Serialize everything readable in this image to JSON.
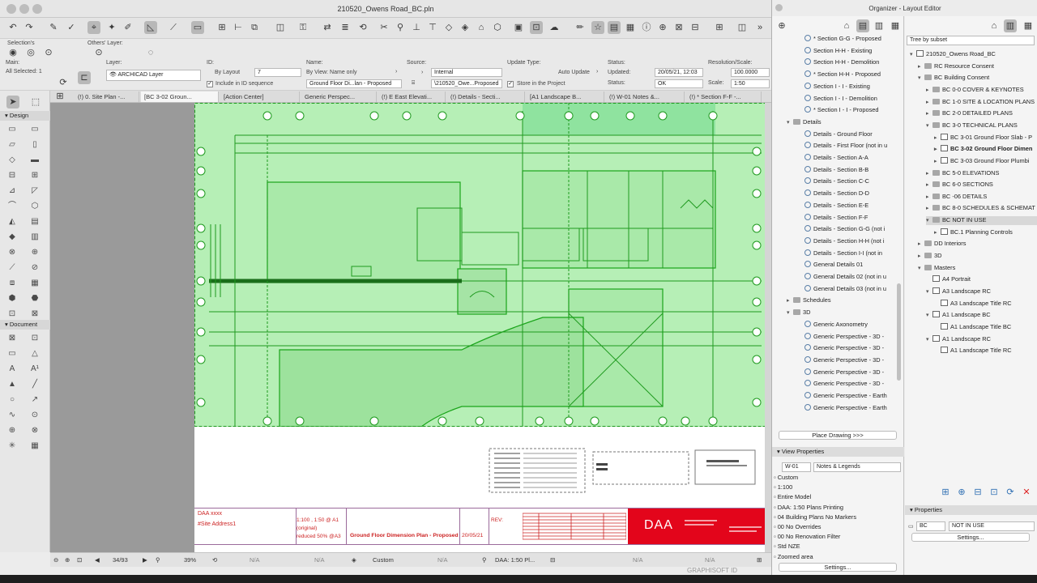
{
  "window": {
    "title": "210520_Owens Road_BC.pln"
  },
  "organizer": {
    "title": "Organizer - Layout Editor",
    "tree_mode": "Tree by subset",
    "left_items": [
      {
        "label": "* Section G-G - Proposed",
        "icon": "view"
      },
      {
        "label": "Section H-H - Existing",
        "icon": "view"
      },
      {
        "label": "Section H-H - Demolition",
        "icon": "view"
      },
      {
        "label": "* Section H-H - Proposed",
        "icon": "view"
      },
      {
        "label": "Section I - I - Existing",
        "icon": "view"
      },
      {
        "label": "Section I - I - Demolition",
        "icon": "view"
      },
      {
        "label": "* Section I - I - Proposed",
        "icon": "view"
      },
      {
        "label": "Details",
        "icon": "folder",
        "folder": true
      },
      {
        "label": "Details - Ground Floor",
        "icon": "view"
      },
      {
        "label": "Details - First Floor (not in u",
        "icon": "view"
      },
      {
        "label": "Details - Section A-A",
        "icon": "view"
      },
      {
        "label": "Details - Section B-B",
        "icon": "view"
      },
      {
        "label": "Details - Section C-C",
        "icon": "view"
      },
      {
        "label": "Details - Section D-D",
        "icon": "view"
      },
      {
        "label": "Details - Section E-E",
        "icon": "view"
      },
      {
        "label": "Details - Section F-F",
        "icon": "view"
      },
      {
        "label": "Details - Section G-G (not i",
        "icon": "view"
      },
      {
        "label": "Details - Section H-H (not i",
        "icon": "view"
      },
      {
        "label": "Details - Section I-I (not in",
        "icon": "view"
      },
      {
        "label": "General Details 01",
        "icon": "view"
      },
      {
        "label": "General Details 02 (not in u",
        "icon": "view"
      },
      {
        "label": "General Details 03 (not in u",
        "icon": "view"
      },
      {
        "label": "Schedules",
        "icon": "folder",
        "folder": true,
        "collapsed": true
      },
      {
        "label": "3D",
        "icon": "folder",
        "folder": true
      },
      {
        "label": "Generic Axonometry",
        "icon": "view"
      },
      {
        "label": "Generic Perspective - 3D -",
        "icon": "view"
      },
      {
        "label": "Generic Perspective - 3D -",
        "icon": "view"
      },
      {
        "label": "Generic Perspective - 3D -",
        "icon": "view"
      },
      {
        "label": "Generic Perspective - 3D -",
        "icon": "view"
      },
      {
        "label": "Generic Perspective - 3D -",
        "icon": "view"
      },
      {
        "label": "Generic Perspective - Earth",
        "icon": "view"
      },
      {
        "label": "Generic Perspective - Earth",
        "icon": "view"
      }
    ],
    "place_drawing": "Place Drawing >>>",
    "view_properties": {
      "title": "View Properties",
      "id": "W-01",
      "name": "Notes & Legends",
      "rows": [
        "Custom",
        "1:100",
        "Entire Model",
        "DAA: 1:50 Plans Printing",
        "04 Building Plans No Markers",
        "00 No Overrides",
        "00 No Renovation Filter",
        "Std NZE",
        "Zoomed area"
      ],
      "settings": "Settings..."
    },
    "right_items": [
      {
        "label": "210520_Owens Road_BC",
        "indent": 0,
        "icon": "book",
        "exp": "v"
      },
      {
        "label": "RC Resource Consent",
        "indent": 1,
        "icon": "folder",
        "exp": ">"
      },
      {
        "label": "BC Building Consent",
        "indent": 1,
        "icon": "folder",
        "exp": "v"
      },
      {
        "label": "BC 0-0 COVER & KEYNOTES",
        "indent": 2,
        "icon": "folder",
        "exp": ">"
      },
      {
        "label": "BC 1-0 SITE & LOCATION PLANS",
        "indent": 2,
        "icon": "folder",
        "exp": ">"
      },
      {
        "label": "BC 2-0 DETAILED PLANS",
        "indent": 2,
        "icon": "folder",
        "exp": ">"
      },
      {
        "label": "BC 3-0 TECHNICAL PLANS",
        "indent": 2,
        "icon": "folder",
        "exp": "v"
      },
      {
        "label": "BC 3-01 Ground Floor Slab - P",
        "indent": 3,
        "icon": "page",
        "exp": ">"
      },
      {
        "label": "BC 3-02 Ground Floor Dimen",
        "indent": 3,
        "icon": "page",
        "exp": ">",
        "bold": true
      },
      {
        "label": "BC 3-03 Ground Floor Plumbi",
        "indent": 3,
        "icon": "page",
        "exp": ">"
      },
      {
        "label": "BC 5-0 ELEVATIONS",
        "indent": 2,
        "icon": "folder",
        "exp": ">"
      },
      {
        "label": "BC 6-0 SECTIONS",
        "indent": 2,
        "icon": "folder",
        "exp": ">"
      },
      {
        "label": "BC -06 DETAILS",
        "indent": 2,
        "icon": "folder",
        "exp": ">"
      },
      {
        "label": "BC 8-0 SCHEDULES & SCHEMAT",
        "indent": 2,
        "icon": "folder",
        "exp": ">"
      },
      {
        "label": "BC NOT IN USE",
        "indent": 2,
        "icon": "folder",
        "exp": "v",
        "selected": true
      },
      {
        "label": "BC.1 Planning Controls",
        "indent": 3,
        "icon": "page",
        "exp": ">"
      },
      {
        "label": "DD Interiors",
        "indent": 1,
        "icon": "folder",
        "exp": ">"
      },
      {
        "label": "3D",
        "indent": 1,
        "icon": "folder",
        "exp": ">"
      },
      {
        "label": "Masters",
        "indent": 1,
        "icon": "folder",
        "exp": "v"
      },
      {
        "label": "A4 Portrait",
        "indent": 2,
        "icon": "page",
        "exp": ""
      },
      {
        "label": "A3 Landscape RC",
        "indent": 2,
        "icon": "page",
        "exp": "v"
      },
      {
        "label": "A3 Landscape Title RC",
        "indent": 3,
        "icon": "page",
        "exp": ""
      },
      {
        "label": "A1 Landscape BC",
        "indent": 2,
        "icon": "page",
        "exp": "v"
      },
      {
        "label": "A1 Landscape Title BC",
        "indent": 3,
        "icon": "page",
        "exp": ""
      },
      {
        "label": "A1 Landscape RC",
        "indent": 2,
        "icon": "page",
        "exp": "v"
      },
      {
        "label": "A1 Landscape Title RC",
        "indent": 3,
        "icon": "page",
        "exp": ""
      }
    ],
    "properties": {
      "title": "Properties",
      "id": "BC",
      "name": "NOT IN USE",
      "settings": "Settings..."
    }
  },
  "info": {
    "main_label": "Main:",
    "all_selected": "All Selected: 1",
    "layer_label": "Layer:",
    "layer": "ARCHICAD Layer",
    "selections_label": "Selection's",
    "others_layer_label": "Others' Layer:",
    "id_label": "ID:",
    "id_mode": "By Layout",
    "id_value": "7",
    "include_id": "Include in ID sequence",
    "name_label": "Name:",
    "name_mode": "By View: Name only",
    "name_value": "Ground Floor Di...lan - Proposed",
    "source_label": "Source:",
    "source_internal": "Internal",
    "source_file": "\\210520_Owe...Proposed",
    "update_label": "Update Type:",
    "auto_update": "Auto Update",
    "store": "Store in the Project",
    "status_label": "Status:",
    "updated_label": "Updated:",
    "updated_value": "20/05/21, 12:03",
    "status2_label": "Status:",
    "status_value": "OK",
    "res_label": "Resolution/Scale:",
    "res_value": "100.0000",
    "scale_label": "Scale:",
    "scale_value": "1:50"
  },
  "tabs": [
    {
      "label": "(!) 0. Site Plan -...",
      "active": false
    },
    {
      "label": "[BC 3-02 Groun...",
      "active": true
    },
    {
      "label": "[Action Center]",
      "active": false
    },
    {
      "label": "Generic Perspec...",
      "active": false
    },
    {
      "label": "(!) E East Elevati...",
      "active": false
    },
    {
      "label": "(!) Details - Secti...",
      "active": false
    },
    {
      "label": "[A1 Landscape B...",
      "active": false
    },
    {
      "label": "(!) W-01 Notes &...",
      "active": false
    },
    {
      "label": "(!) * Section F-F -...",
      "active": false
    }
  ],
  "toolbox": {
    "design": "Design",
    "document": "Document"
  },
  "titleblock": {
    "client": "DAA xxxx",
    "address": "#Site Address1",
    "scale_text": "1:100 , 1:50 @ A1",
    "original": "(original)",
    "reduced": "reduced 50% @A3",
    "drawing_title": "Ground Floor Dimension Plan - Proposed",
    "date": "20/05/21",
    "rev": "REV:",
    "brand": "DAA",
    "brand_color": "#e3051b"
  },
  "statusbar": {
    "page": "34/93",
    "zoom": "39%",
    "na1": "N/A",
    "na2": "N/A",
    "na3": "N/A",
    "na4": "N/A",
    "na5": "N/A",
    "custom": "Custom",
    "penset": "DAA: 1:50 Pl..."
  },
  "footer": {
    "graphisoft": "GRAPHISOFT ID"
  }
}
